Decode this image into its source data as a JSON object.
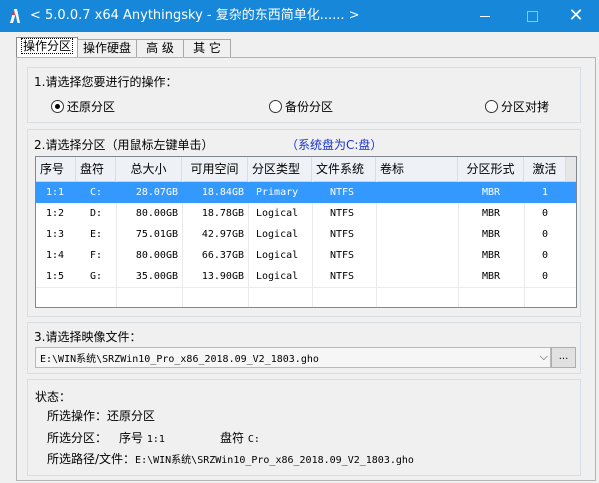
{
  "window": {
    "title": "< 5.0.0.7 x64 Anythingsky - 复杂的东西简单化...... >",
    "accent": "#1687d9"
  },
  "tabs": [
    {
      "label": "操作分区",
      "active": true
    },
    {
      "label": "操作硬盘",
      "active": false
    },
    {
      "label": "高 级",
      "active": false
    },
    {
      "label": "其 它",
      "active": false
    }
  ],
  "operation": {
    "title": "1.请选择您要进行的操作：",
    "options": [
      {
        "label": "还原分区",
        "selected": true
      },
      {
        "label": "备份分区",
        "selected": false
      },
      {
        "label": "分区对拷",
        "selected": false
      }
    ]
  },
  "partition": {
    "title": "2.请选择分区（用鼠标左键单击）",
    "system_note": "（系统盘为C:盘）",
    "columns": [
      "序号",
      "盘符",
      "总大小",
      "可用空间",
      "分区类型",
      "文件系统",
      "卷标",
      "分区形式",
      "激活"
    ],
    "rows": [
      {
        "no": "1:1",
        "drive": "C:",
        "total": "28.07GB",
        "free": "18.84GB",
        "type": "Primary",
        "fs": "NTFS",
        "label": "",
        "style": "MBR",
        "active": "1",
        "selected": true
      },
      {
        "no": "1:2",
        "drive": "D:",
        "total": "80.00GB",
        "free": "18.78GB",
        "type": "Logical",
        "fs": "NTFS",
        "label": "",
        "style": "MBR",
        "active": "0",
        "selected": false
      },
      {
        "no": "1:3",
        "drive": "E:",
        "total": "75.01GB",
        "free": "42.97GB",
        "type": "Logical",
        "fs": "NTFS",
        "label": "",
        "style": "MBR",
        "active": "0",
        "selected": false
      },
      {
        "no": "1:4",
        "drive": "F:",
        "total": "80.00GB",
        "free": "66.37GB",
        "type": "Logical",
        "fs": "NTFS",
        "label": "",
        "style": "MBR",
        "active": "0",
        "selected": false
      },
      {
        "no": "1:5",
        "drive": "G:",
        "total": "35.00GB",
        "free": "13.90GB",
        "type": "Logical",
        "fs": "NTFS",
        "label": "",
        "style": "MBR",
        "active": "0",
        "selected": false
      }
    ]
  },
  "image_file": {
    "title": "3.请选择映像文件：",
    "value": "E:\\WIN系统\\SRZWin10_Pro_x86_2018.09_V2_1803.gho",
    "browse_label": "..."
  },
  "status": {
    "title": "状态：",
    "operation_label": "所选操作：",
    "operation_value": "还原分区",
    "partition_label": "所选分区：",
    "partition_no_label": "序号",
    "partition_no": "1:1",
    "partition_drive_label": "盘符",
    "partition_drive": "C:",
    "path_label": "所选路径/文件：",
    "path_value": "E:\\WIN系统\\SRZWin10_Pro_x86_2018.09_V2_1803.gho"
  }
}
